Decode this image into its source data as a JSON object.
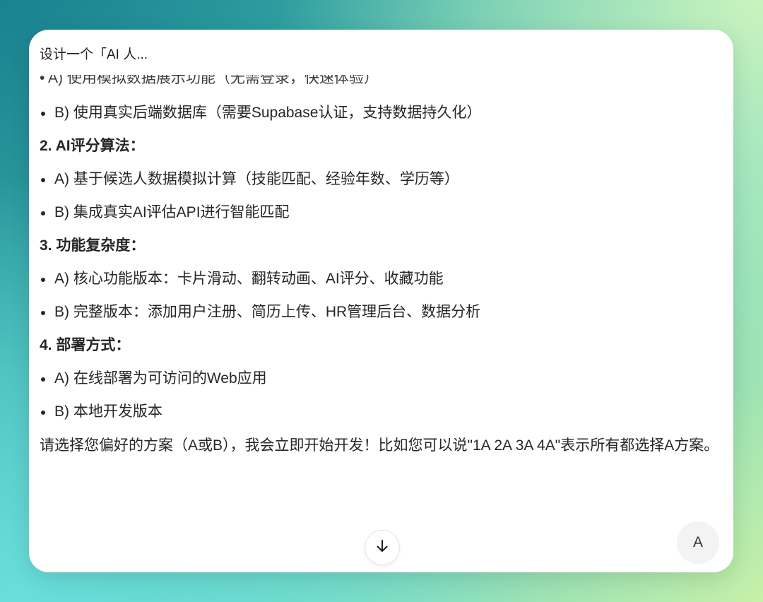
{
  "card": {
    "title": "设计一个「AI 人...",
    "clipped_line": "• A) 使用模拟数据展示功能（无需登录，快速体验）"
  },
  "sections": [
    {
      "items": [
        "B) 使用真实后端数据库（需要Supabase认证，支持数据持久化）"
      ]
    },
    {
      "heading": "2. AI评分算法：",
      "items": [
        "A) 基于候选人数据模拟计算（技能匹配、经验年数、学历等）",
        "B) 集成真实AI评估API进行智能匹配"
      ]
    },
    {
      "heading": "3. 功能复杂度：",
      "items": [
        "A) 核心功能版本：卡片滑动、翻转动画、AI评分、收藏功能",
        "B) 完整版本：添加用户注册、简历上传、HR管理后台、数据分析"
      ]
    },
    {
      "heading": "4. 部署方式：",
      "items": [
        "A) 在线部署为可访问的Web应用",
        "B) 本地开发版本"
      ]
    }
  ],
  "closing": "请选择您偏好的方案（A或B），我会立即开始开发！比如您可以说\"1A 2A 3A 4A\"表示所有都选择A方案。",
  "controls": {
    "scroll_icon": "arrow-down-icon",
    "avatar_letter": "A"
  }
}
